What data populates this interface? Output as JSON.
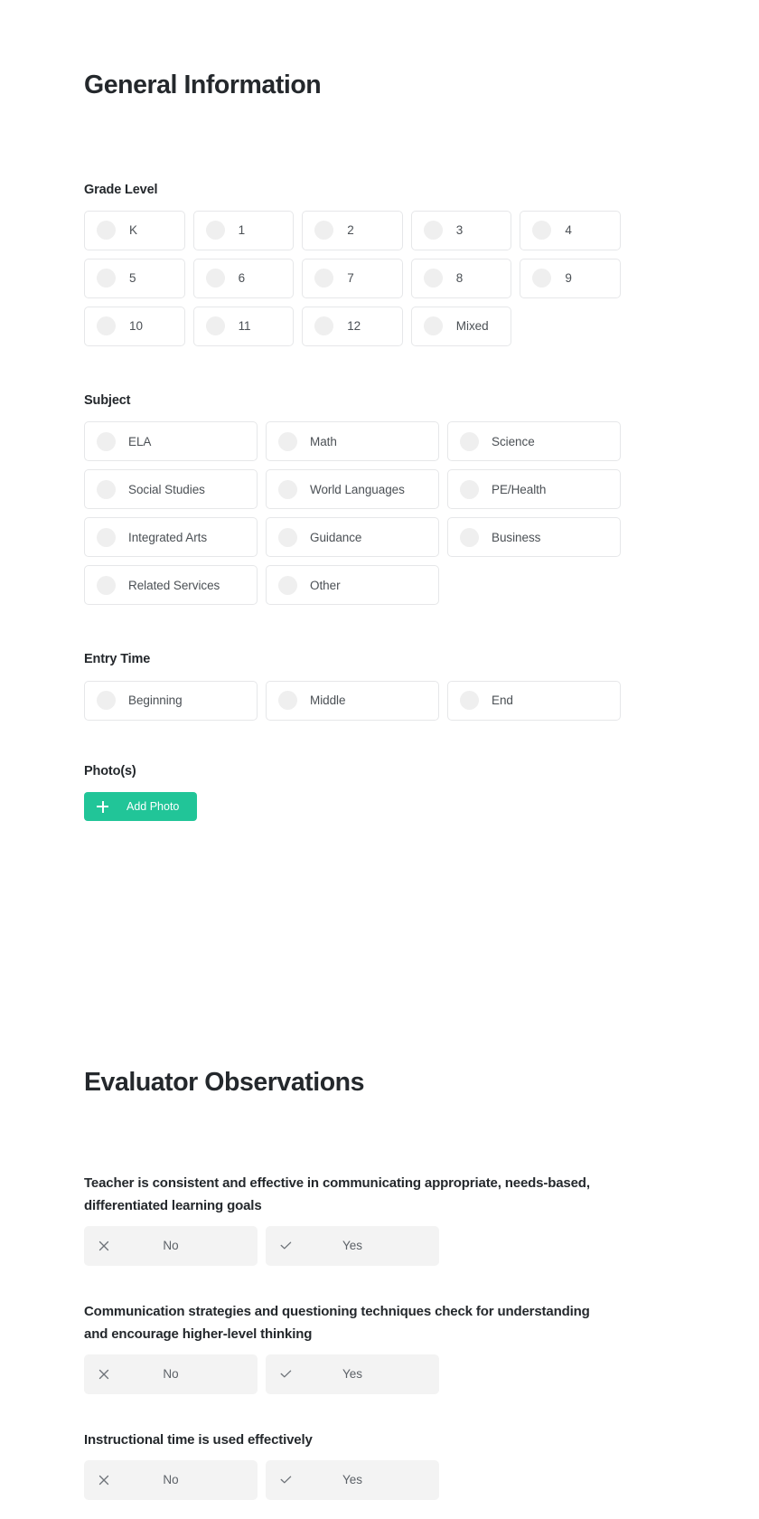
{
  "theme": {
    "accent": "#21c598",
    "card_border": "#e6e7e9",
    "radio_fill": "#efefef",
    "toggle_bg": "#f3f3f3",
    "heading_color": "#24282c",
    "label_color": "#4b5055"
  },
  "sections": [
    {
      "title": "General Information"
    },
    {
      "title": "Evaluator Observations"
    }
  ],
  "general": {
    "title": "General Information",
    "grade_level": {
      "label": "Grade Level",
      "options": [
        "K",
        "1",
        "2",
        "3",
        "4",
        "5",
        "6",
        "7",
        "8",
        "9",
        "10",
        "11",
        "12",
        "Mixed"
      ]
    },
    "subject": {
      "label": "Subject",
      "options": [
        "ELA",
        "Math",
        "Science",
        "Social Studies",
        "World Languages",
        "PE/Health",
        "Integrated Arts",
        "Guidance",
        "Business",
        "Related Services",
        "Other"
      ]
    },
    "entry_time": {
      "label": "Entry Time",
      "options": [
        "Beginning",
        "Middle",
        "End"
      ]
    },
    "photos": {
      "label": "Photo(s)",
      "add_button": "Add Photo",
      "add_icon": "plus-icon"
    }
  },
  "evaluator": {
    "title": "Evaluator Observations",
    "toggle": {
      "no_label": "No",
      "yes_label": "Yes",
      "no_icon": "x-icon",
      "yes_icon": "check-icon"
    },
    "questions": [
      {
        "text": "Teacher is consistent and effective in communicating appropriate, needs-based, differentiated learning goals"
      },
      {
        "text": "Communication strategies and questioning techniques check for understanding and encourage higher-level thinking"
      },
      {
        "text": "Instructional time is used effectively"
      }
    ]
  }
}
